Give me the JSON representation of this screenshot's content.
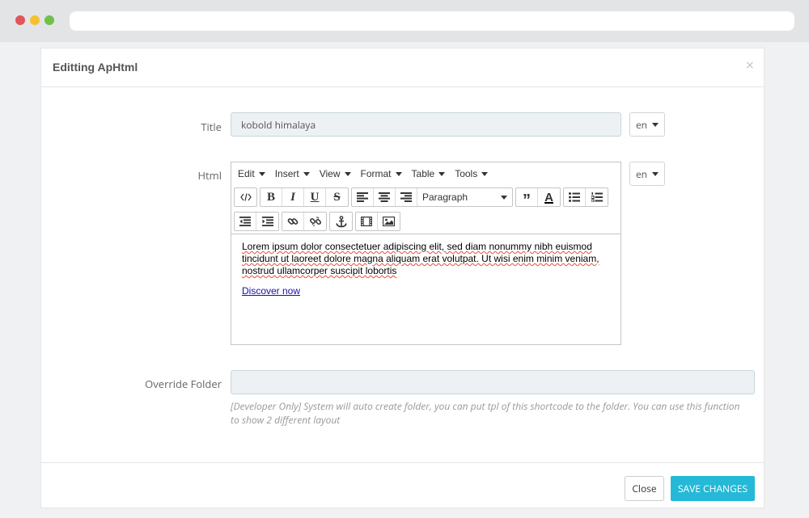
{
  "modal": {
    "title": "Editting ApHtml",
    "close_symbol": "×"
  },
  "form": {
    "title_label": "Title",
    "title_value": "kobold himalaya",
    "title_lang": "en",
    "html_label": "Html",
    "html_lang": "en",
    "override_label": "Override Folder",
    "override_value": "",
    "override_help": "[Developer Only] System will auto create folder, you can put tpl of this shortcode to the folder. You can use this function to show 2 different layout"
  },
  "editor": {
    "menus": [
      "Edit",
      "Insert",
      "View",
      "Format",
      "Table",
      "Tools"
    ],
    "format_select": "Paragraph",
    "toolbar_icons": [
      "code-icon",
      "bold-icon",
      "italic-icon",
      "underline-icon",
      "strikethrough-icon",
      "align-left-icon",
      "align-center-icon",
      "align-right-icon",
      "blockquote-icon",
      "text-color-icon",
      "bullet-list-icon",
      "numbered-list-icon",
      "outdent-icon",
      "indent-icon",
      "link-icon",
      "unlink-icon",
      "anchor-icon",
      "media-icon",
      "image-icon"
    ],
    "content_paragraph": "Lorem ipsum dolor consectetuer adipiscing elit, sed diam nonummy nibh euismod tincidunt ut laoreet dolore magna aliquam erat volutpat. Ut wisi enim minim veniam, nostrud ullamcorper suscipit lobortis",
    "content_link": "Discover now"
  },
  "footer": {
    "close_label": "Close",
    "save_label": "Save Changes"
  },
  "colors": {
    "accent": "#25b9d7",
    "link": "#1a0dab"
  }
}
